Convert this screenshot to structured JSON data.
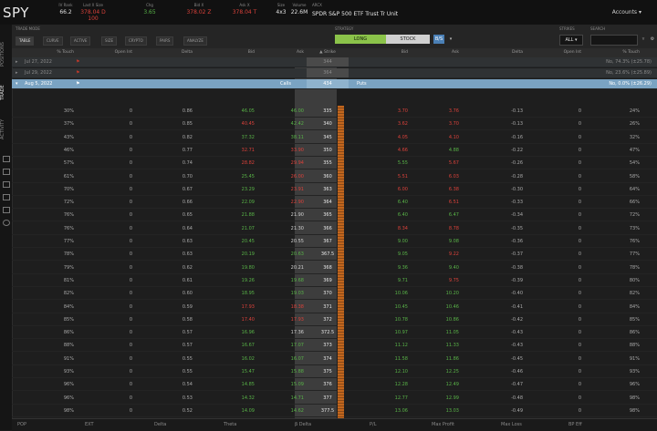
{
  "header": {
    "symbol": "SPY",
    "quotes": [
      {
        "label": "IV Rank",
        "value": "66.2",
        "color": "wht"
      },
      {
        "label": "Last X Size",
        "value": "378.04 D 100",
        "color": "red"
      },
      {
        "label": "Chg",
        "value": "3.65",
        "color": "grn"
      },
      {
        "label": "Bid X",
        "value": "378.02 Z",
        "color": "red"
      },
      {
        "label": "Ask X",
        "value": "378.04 T",
        "color": "red"
      },
      {
        "label": "Size",
        "value": "4x3",
        "color": "wht"
      },
      {
        "label": "Volume",
        "value": "22.6M",
        "color": "wht"
      }
    ],
    "desc_label": "ARCX",
    "description": "SPDR S&P 500 ETF Trust Tr Unit",
    "account": "Accounts"
  },
  "sidebar": {
    "tabs": [
      "POSITIONS",
      "TRADE",
      "ACTIVITY"
    ]
  },
  "toolbar": {
    "left_label": "TRADE MODE",
    "modes": [
      "TABLE",
      "CURVE",
      "ACTIVE",
      "SIZE",
      "CRYPTO",
      "PAIRS",
      "ANALYZE"
    ],
    "strategy_label": "STRATEGY",
    "long": "LONG",
    "stock": "STOCK",
    "strategy_btn": "B/S",
    "filter_label": "STRIKES",
    "filter": "ALL",
    "search_label": "SEARCH"
  },
  "columns": {
    "calls": [
      "% Touch",
      "Open Int",
      "Delta",
      "Bid",
      "Ask"
    ],
    "strike": "Strike",
    "puts": [
      "Bid",
      "Ask",
      "Delta",
      "Open Int",
      "% Touch"
    ]
  },
  "expirations": [
    {
      "date": "Jul 27, 2022",
      "strike": "344",
      "summary": "No, 74.3% (±25.78)",
      "calls": "",
      "puts": ""
    },
    {
      "date": "Jul 29, 2022",
      "strike": "364",
      "summary": "No, 23.6% (±25.89)",
      "calls": "",
      "puts": ""
    },
    {
      "date": "Aug 5, 2022",
      "strike": "434",
      "summary": "No, 0.0% (±26.29)",
      "calls": "Calls",
      "puts": "Puts"
    }
  ],
  "rows": [
    {
      "ct": "30%",
      "coi": "0",
      "cd": "0.86",
      "cb": "46.05",
      "ca": "46.00",
      "s": "335",
      "pb": "3.70",
      "pa": "3.76",
      "pd": "-0.13",
      "poi": "0",
      "pt": "24%"
    },
    {
      "ct": "37%",
      "coi": "0",
      "cd": "0.85",
      "cb": "40.45",
      "ca": "42.42",
      "s": "340",
      "pb": "3.62",
      "pa": "3.70",
      "pd": "-0.13",
      "poi": "0",
      "pt": "26%"
    },
    {
      "ct": "43%",
      "coi": "0",
      "cd": "0.82",
      "cb": "37.32",
      "ca": "38.11",
      "s": "345",
      "pb": "4.05",
      "pa": "4.10",
      "pd": "-0.16",
      "poi": "0",
      "pt": "32%"
    },
    {
      "ct": "46%",
      "coi": "0",
      "cd": "0.77",
      "cb": "32.71",
      "ca": "33.90",
      "s": "350",
      "pb": "4.66",
      "pa": "4.88",
      "pd": "-0.22",
      "poi": "0",
      "pt": "47%"
    },
    {
      "ct": "57%",
      "coi": "0",
      "cd": "0.74",
      "cb": "28.82",
      "ca": "29.94",
      "s": "355",
      "pb": "5.55",
      "pa": "5.67",
      "pd": "-0.26",
      "poi": "0",
      "pt": "54%"
    },
    {
      "ct": "61%",
      "coi": "0",
      "cd": "0.70",
      "cb": "25.45",
      "ca": "26.00",
      "s": "360",
      "pb": "5.51",
      "pa": "6.03",
      "pd": "-0.28",
      "poi": "0",
      "pt": "58%"
    },
    {
      "ct": "70%",
      "coi": "0",
      "cd": "0.67",
      "cb": "23.29",
      "ca": "23.91",
      "s": "363",
      "pb": "6.00",
      "pa": "6.38",
      "pd": "-0.30",
      "poi": "0",
      "pt": "64%"
    },
    {
      "ct": "72%",
      "coi": "0",
      "cd": "0.66",
      "cb": "22.09",
      "ca": "22.90",
      "s": "364",
      "pb": "6.40",
      "pa": "6.51",
      "pd": "-0.33",
      "poi": "0",
      "pt": "66%"
    },
    {
      "ct": "76%",
      "coi": "0",
      "cd": "0.65",
      "cb": "21.88",
      "ca": "21.90",
      "s": "365",
      "pb": "6.40",
      "pa": "6.47",
      "pd": "-0.34",
      "poi": "0",
      "pt": "72%"
    },
    {
      "ct": "76%",
      "coi": "0",
      "cd": "0.64",
      "cb": "21.07",
      "ca": "21.30",
      "s": "366",
      "pb": "8.34",
      "pa": "8.78",
      "pd": "-0.35",
      "poi": "0",
      "pt": "73%"
    },
    {
      "ct": "77%",
      "coi": "0",
      "cd": "0.63",
      "cb": "20.45",
      "ca": "20.55",
      "s": "367",
      "pb": "9.00",
      "pa": "9.08",
      "pd": "-0.36",
      "poi": "0",
      "pt": "76%"
    },
    {
      "ct": "78%",
      "coi": "0",
      "cd": "0.63",
      "cb": "20.19",
      "ca": "20.63",
      "s": "367.5",
      "pb": "9.05",
      "pa": "9.22",
      "pd": "-0.37",
      "poi": "0",
      "pt": "77%"
    },
    {
      "ct": "79%",
      "coi": "0",
      "cd": "0.62",
      "cb": "19.80",
      "ca": "20.21",
      "s": "368",
      "pb": "9.36",
      "pa": "9.40",
      "pd": "-0.38",
      "poi": "0",
      "pt": "78%"
    },
    {
      "ct": "81%",
      "coi": "0",
      "cd": "0.61",
      "cb": "19.26",
      "ca": "19.68",
      "s": "369",
      "pb": "9.71",
      "pa": "9.75",
      "pd": "-0.39",
      "poi": "0",
      "pt": "80%"
    },
    {
      "ct": "82%",
      "coi": "0",
      "cd": "0.60",
      "cb": "18.95",
      "ca": "19.03",
      "s": "370",
      "pb": "10.06",
      "pa": "10.20",
      "pd": "-0.40",
      "poi": "0",
      "pt": "82%"
    },
    {
      "ct": "84%",
      "coi": "0",
      "cd": "0.59",
      "cb": "17.93",
      "ca": "18.38",
      "s": "371",
      "pb": "10.45",
      "pa": "10.46",
      "pd": "-0.41",
      "poi": "0",
      "pt": "84%"
    },
    {
      "ct": "85%",
      "coi": "0",
      "cd": "0.58",
      "cb": "17.40",
      "ca": "17.93",
      "s": "372",
      "pb": "10.78",
      "pa": "10.86",
      "pd": "-0.42",
      "poi": "0",
      "pt": "85%"
    },
    {
      "ct": "86%",
      "coi": "0",
      "cd": "0.57",
      "cb": "16.96",
      "ca": "17.36",
      "s": "372.5",
      "pb": "10.97",
      "pa": "11.05",
      "pd": "-0.43",
      "poi": "0",
      "pt": "86%"
    },
    {
      "ct": "88%",
      "coi": "0",
      "cd": "0.57",
      "cb": "16.67",
      "ca": "17.07",
      "s": "373",
      "pb": "11.12",
      "pa": "11.33",
      "pd": "-0.43",
      "poi": "0",
      "pt": "88%"
    },
    {
      "ct": "91%",
      "coi": "0",
      "cd": "0.55",
      "cb": "16.02",
      "ca": "16.07",
      "s": "374",
      "pb": "11.58",
      "pa": "11.86",
      "pd": "-0.45",
      "poi": "0",
      "pt": "91%"
    },
    {
      "ct": "93%",
      "coi": "0",
      "cd": "0.55",
      "cb": "15.47",
      "ca": "15.88",
      "s": "375",
      "pb": "12.10",
      "pa": "12.25",
      "pd": "-0.46",
      "poi": "0",
      "pt": "93%"
    },
    {
      "ct": "96%",
      "coi": "0",
      "cd": "0.54",
      "cb": "14.85",
      "ca": "15.09",
      "s": "376",
      "pb": "12.28",
      "pa": "12.49",
      "pd": "-0.47",
      "poi": "0",
      "pt": "96%"
    },
    {
      "ct": "96%",
      "coi": "0",
      "cd": "0.53",
      "cb": "14.32",
      "ca": "14.71",
      "s": "377",
      "pb": "12.77",
      "pa": "12.99",
      "pd": "-0.48",
      "poi": "0",
      "pt": "98%"
    },
    {
      "ct": "98%",
      "coi": "0",
      "cd": "0.52",
      "cb": "14.09",
      "ca": "14.62",
      "s": "377.5",
      "pb": "13.06",
      "pa": "13.03",
      "pd": "-0.49",
      "poi": "0",
      "pt": "98%"
    }
  ],
  "row_colors": {
    "cb": [
      "grn",
      "red",
      "grn",
      "red",
      "red",
      "grn",
      "grn",
      "grn",
      "grn",
      "grn",
      "grn",
      "grn",
      "grn",
      "grn",
      "grn",
      "red",
      "red",
      "grn",
      "grn",
      "grn",
      "grn",
      "grn",
      "grn",
      "grn"
    ],
    "ca": [
      "grn",
      "grn",
      "grn",
      "red",
      "red",
      "red",
      "red",
      "red",
      "wht",
      "wht",
      "wht",
      "grn",
      "wht",
      "grn",
      "grn",
      "red",
      "red",
      "wht",
      "grn",
      "grn",
      "grn",
      "grn",
      "grn",
      "grn"
    ],
    "pb": [
      "red",
      "red",
      "red",
      "red",
      "grn",
      "red",
      "red",
      "grn",
      "grn",
      "red",
      "grn",
      "grn",
      "grn",
      "grn",
      "grn",
      "grn",
      "grn",
      "grn",
      "grn",
      "grn",
      "grn",
      "grn",
      "grn",
      "grn"
    ],
    "pa": [
      "red",
      "red",
      "red",
      "grn",
      "red",
      "red",
      "red",
      "red",
      "grn",
      "red",
      "grn",
      "red",
      "grn",
      "red",
      "grn",
      "grn",
      "grn",
      "grn",
      "grn",
      "grn",
      "grn",
      "grn",
      "grn",
      "grn"
    ]
  },
  "footer": [
    "POP",
    "EXT",
    "Delta",
    "Theta",
    "β Delta",
    "P/L",
    "Max Profit",
    "Max Loss",
    "BP Eff"
  ]
}
